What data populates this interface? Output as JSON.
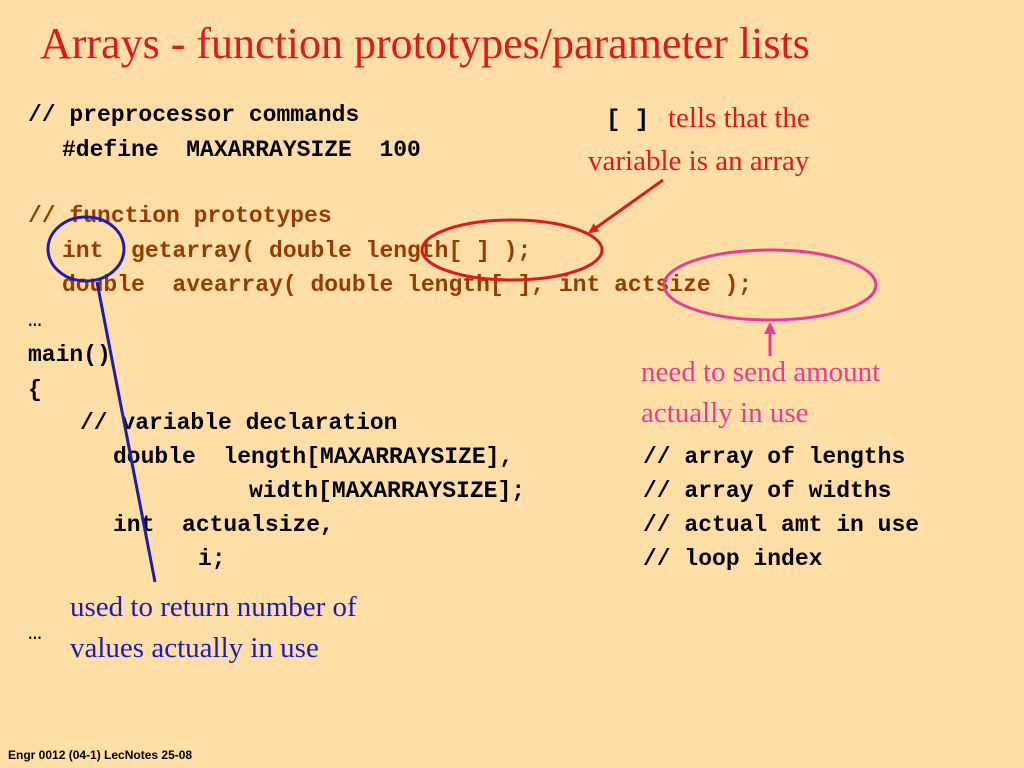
{
  "title": "Arrays - function prototypes/parameter lists",
  "code": {
    "preproc_comment": "// preprocessor commands",
    "define_line": "#define  MAXARRAYSIZE  100",
    "proto_comment": "// function prototypes",
    "proto1": "int  getarray( double length[ ] );",
    "proto2": "double  avearray( double length[ ], int actsize );",
    "ellipsis1": "…",
    "main": "main()",
    "brace": "{",
    "var_comment": "// variable declaration",
    "decl1": "double  length[MAXARRAYSIZE],",
    "decl1_comment": "// array of lengths",
    "decl2": "width[MAXARRAYSIZE];",
    "decl2_comment": "// array of widths",
    "decl3": "int  actualsize,",
    "decl3_comment": "// actual amt in use",
    "decl4": "i;",
    "decl4_comment": "// loop index",
    "ellipsis2": "…"
  },
  "notes": {
    "brackets": "[ ]",
    "array_note_line1": "tells that the",
    "array_note_line2": "variable is an array",
    "amount_note_line1": "need to send amount",
    "amount_note_line2": "actually in use",
    "return_note_line1": "used to return number of",
    "return_note_line2": "values actually in use"
  },
  "footer": "Engr 0012 (04-1) LecNotes 25-08",
  "colors": {
    "background": "#FFDFA6",
    "title": "#E0191E",
    "code_comment": "#963C00",
    "red_annotation": "#E0191E",
    "pink_annotation": "#EC3A9A",
    "blue_annotation": "#1C1CB8"
  }
}
